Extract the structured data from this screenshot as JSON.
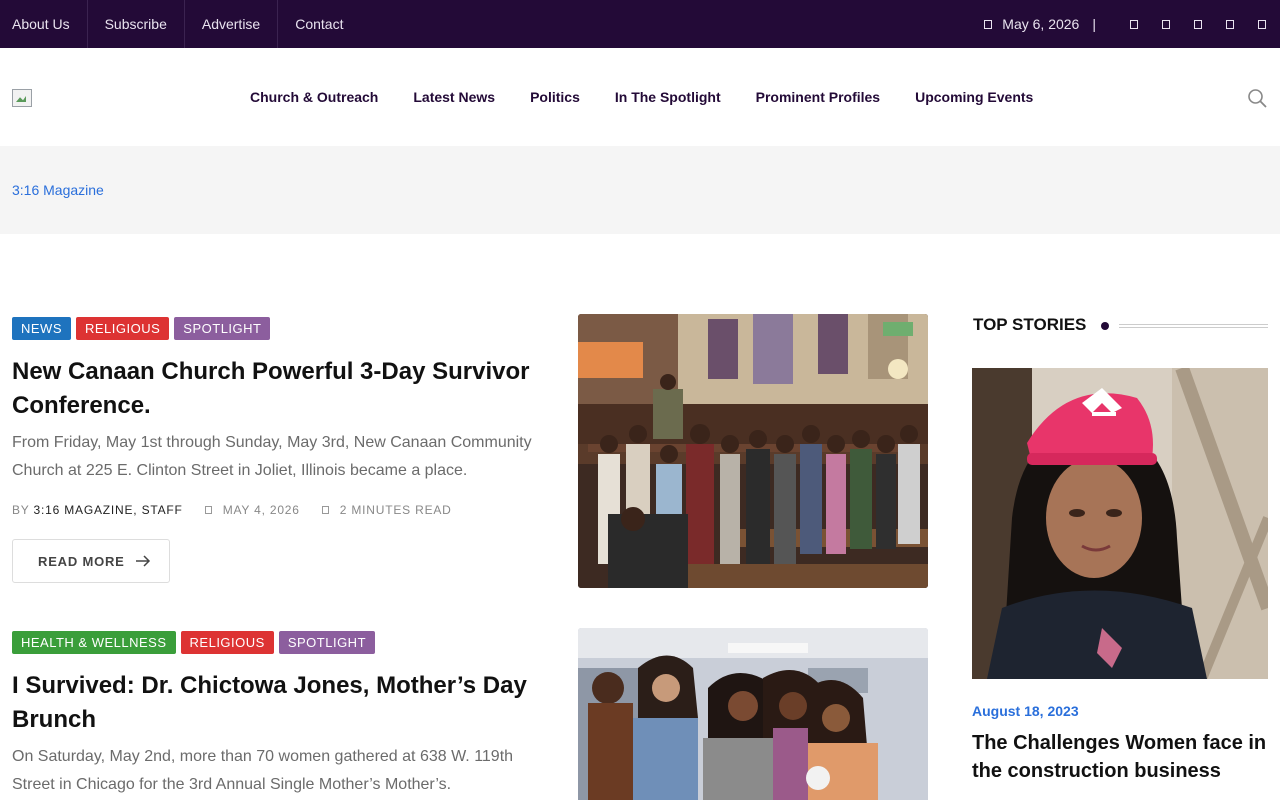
{
  "topbar": {
    "links": [
      "About Us",
      "Subscribe",
      "Advertise",
      "Contact"
    ],
    "date": "May 6, 2026",
    "separator": "|",
    "social_icons": [
      "facebook-icon",
      "twitter-icon",
      "instagram-icon",
      "youtube-icon",
      "linkedin-icon"
    ],
    "background": "#230a37"
  },
  "header": {
    "logo_icon": "broken-image-icon",
    "nav": [
      "Church & Outreach",
      "Latest News",
      "Politics",
      "In The Spotlight",
      "Prominent Profiles",
      "Upcoming Events"
    ],
    "search_icon": "search-icon"
  },
  "breadcrumb": {
    "home": "3:16 Magazine"
  },
  "articles": [
    {
      "tags": [
        {
          "label": "News",
          "color": "#1e73be"
        },
        {
          "label": "Religious",
          "color": "#dd3333"
        },
        {
          "label": "Spotlight",
          "color": "#8c5e9e"
        }
      ],
      "title": "New Canaan Church Powerful 3-Day Survivor Conference.",
      "excerpt": "From Friday, May 1st through Sunday, May 3rd, New Canaan Community Church at 225 E. Clinton Street in Joliet, Illinois became a place.",
      "by_prefix": "BY",
      "author": "3:16 MAGAZINE, STAFF",
      "date": "MAY 4, 2026",
      "read_time": "2 MINUTES READ",
      "read_more": "READ MORE"
    },
    {
      "tags": [
        {
          "label": "Health & Wellness",
          "color": "#3a9e3a"
        },
        {
          "label": "Religious",
          "color": "#dd3333"
        },
        {
          "label": "Spotlight",
          "color": "#8c5e9e"
        }
      ],
      "title": "I Survived: Dr. Chictowa Jones, Mother’s Day Brunch",
      "excerpt": "On Saturday, May 2nd, more than 70 women gathered at 638 W. 119th Street in Chicago for the 3rd Annual Single Mother’s Mother’s."
    }
  ],
  "sidebar": {
    "heading": "TOP STORIES",
    "story": {
      "date": "August 18, 2023",
      "title": "The Challenges Women face in the construction business"
    }
  },
  "colors": {
    "accent": "#230a37",
    "link": "#2a6fdb"
  }
}
